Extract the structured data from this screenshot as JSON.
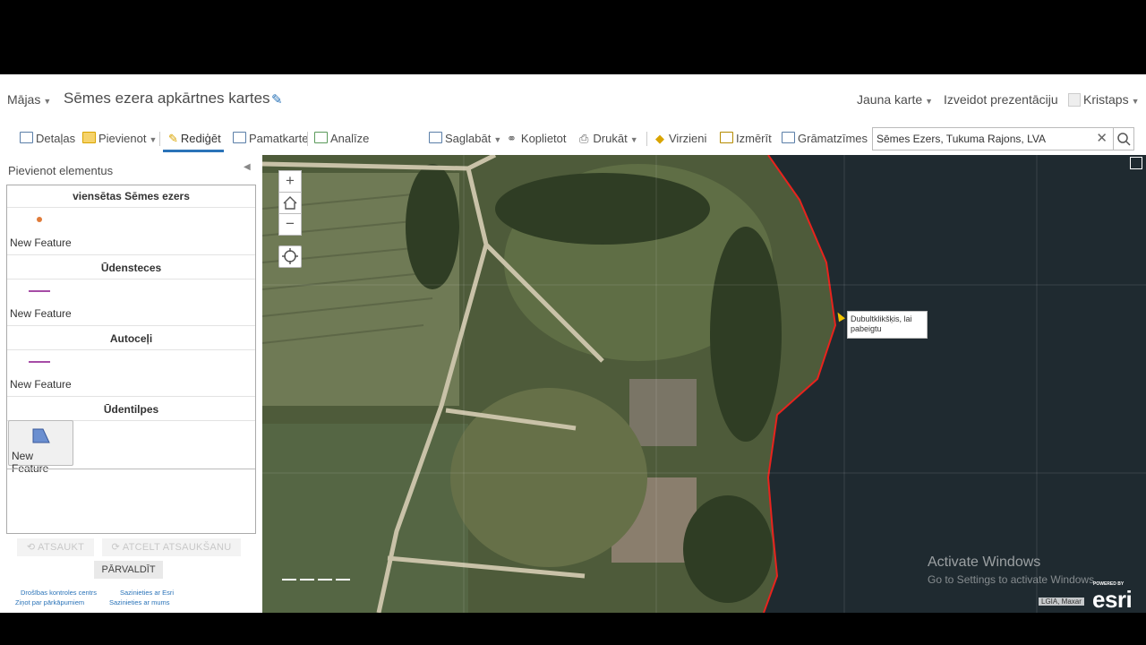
{
  "header": {
    "home_label": "Mājas",
    "map_title": "Sēmes ezera apkārtnes kartes",
    "new_map": "Jauna karte",
    "create_presentation": "Izveidot prezentāciju",
    "user": "Kristaps"
  },
  "toolbar": {
    "details": "Detaļas",
    "add": "Pievienot",
    "edit": "Rediģēt",
    "basemap": "Pamatkarte",
    "analysis": "Analīze",
    "save": "Saglabāt",
    "share": "Koplietot",
    "print": "Drukāt",
    "directions": "Virzieni",
    "measure": "Izmērīt",
    "bookmarks": "Grāmatzīmes"
  },
  "search": {
    "value": "Sēmes Ezers, Tukuma Rajons, LVA"
  },
  "panel": {
    "title": "Pievienot elementus",
    "groups": [
      {
        "name": "viensētas Sēmes ezers",
        "feature": "New Feature"
      },
      {
        "name": "Ūdensteces",
        "feature": "New Feature"
      },
      {
        "name": "Autoceļi",
        "feature": "New Feature"
      },
      {
        "name": "Ūdentilpes",
        "feature": "New Feature"
      }
    ],
    "undo": "ATSAUKT",
    "redo": "ATCELT ATSAUKŠANU",
    "manage": "PĀRVALDĪT",
    "footer": {
      "trust": "Drošības kontroles centrs",
      "contact_esri": "Sazinieties ar Esri",
      "report_abuse": "Ziņot par pārkāpumiem",
      "contact_us": "Sazinieties ar mums"
    }
  },
  "map": {
    "tooltip": "Dubultklikšķis, lai pabeigtu",
    "watermark_title": "Activate Windows",
    "watermark_sub": "Go to Settings to activate Windows.",
    "attribution": "LGIA, Maxar",
    "powered_by": "POWERED BY",
    "esri_logo": "esri",
    "colors": {
      "edit_line": "#e8231d",
      "lake": "#1f2a30"
    }
  }
}
